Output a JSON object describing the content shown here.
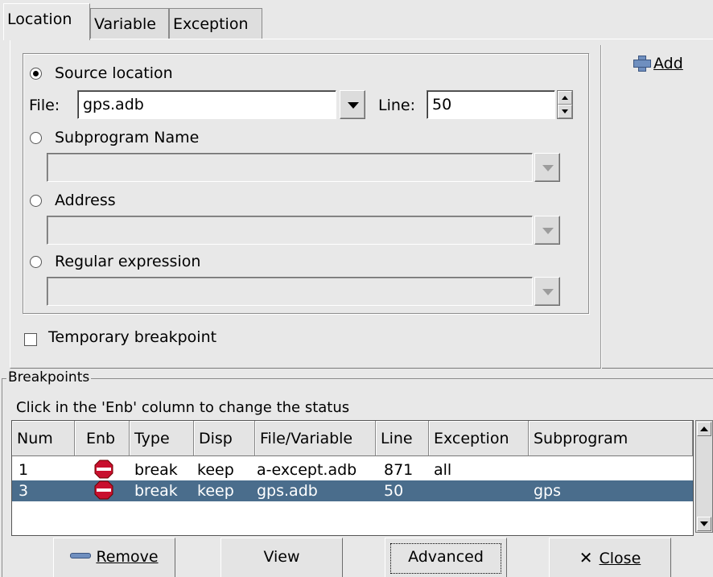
{
  "tabs": [
    "Location",
    "Variable",
    "Exception"
  ],
  "location": {
    "source_location_label": "Source location",
    "file_label": "File:",
    "file_value": "gps.adb",
    "line_label": "Line:",
    "line_value": "50",
    "subprogram_label": "Subprogram Name",
    "address_label": "Address",
    "regex_label": "Regular expression",
    "temporary_label": "Temporary breakpoint"
  },
  "add_label_prefix": "",
  "add_label": "Add",
  "breakpoints": {
    "title": "Breakpoints",
    "hint": "Click in the 'Enb' column to change the status",
    "columns": [
      "Num",
      "Enb",
      "Type",
      "Disp",
      "File/Variable",
      "Line",
      "Exception",
      "Subprogram"
    ],
    "rows": [
      {
        "num": "1",
        "enb_icon": "stop-sign-icon",
        "type": "break",
        "disp": "keep",
        "file": "a-except.adb",
        "line": "871",
        "exception": "all",
        "subprogram": ""
      },
      {
        "num": "3",
        "enb_icon": "stop-sign-icon",
        "type": "break",
        "disp": "keep",
        "file": "gps.adb",
        "line": "50",
        "exception": "",
        "subprogram": "gps"
      }
    ]
  },
  "buttons": {
    "remove": "Remove",
    "view": "View",
    "advanced": "Advanced",
    "close": "Close"
  },
  "colors": {
    "selection": "#4a6d8c",
    "background": "#e8e8e8"
  }
}
